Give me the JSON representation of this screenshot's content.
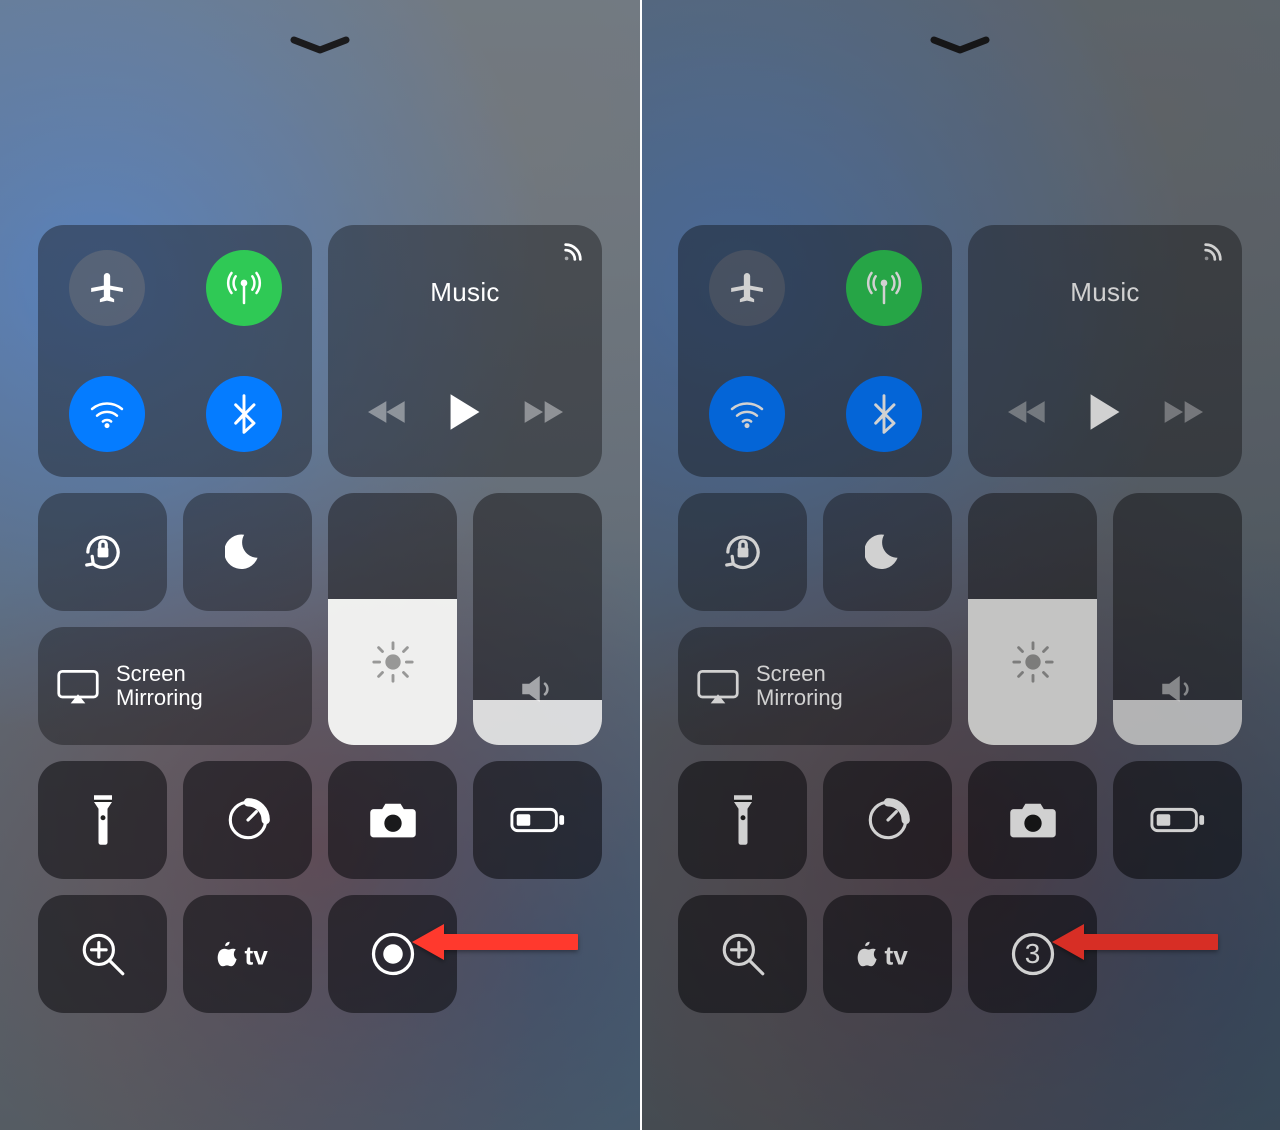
{
  "panels": {
    "left": {
      "media_title": "Music",
      "mirror_label": "Screen\nMirroring",
      "brightness_pct": 58,
      "volume_pct": 18,
      "screen_record": {
        "state": "idle",
        "display": ""
      },
      "connectivity": {
        "airplane_on": false,
        "cellular_on": true,
        "wifi_on": true,
        "bluetooth_on": true
      }
    },
    "right": {
      "media_title": "Music",
      "mirror_label": "Screen\nMirroring",
      "brightness_pct": 58,
      "volume_pct": 18,
      "screen_record": {
        "state": "countdown",
        "display": "3"
      },
      "connectivity": {
        "airplane_on": false,
        "cellular_on": true,
        "wifi_on": true,
        "bluetooth_on": true
      }
    }
  },
  "icons": {
    "dismiss": "chevron-down-icon",
    "airplane": "airplane-icon",
    "cellular": "cellular-antenna-icon",
    "wifi": "wifi-icon",
    "bluetooth": "bluetooth-icon",
    "airplay": "airplay-icon",
    "prev": "rewind-icon",
    "play": "play-icon",
    "next": "fastforward-icon",
    "orientation": "orientation-lock-icon",
    "dnd": "moon-icon",
    "mirror": "screen-mirroring-icon",
    "brightness": "sun-icon",
    "volume": "speaker-icon",
    "flashlight": "flashlight-icon",
    "timer": "timer-icon",
    "camera": "camera-icon",
    "lowpower": "battery-icon",
    "magnifier": "magnifier-icon",
    "appletv": "apple-tv-icon",
    "record": "screen-record-icon",
    "arrow": "annotation-arrow-icon"
  },
  "colors": {
    "toggle_on_green": "#34c759",
    "toggle_on_blue": "#0a7bff",
    "annotation_arrow": "#ff3b30"
  }
}
